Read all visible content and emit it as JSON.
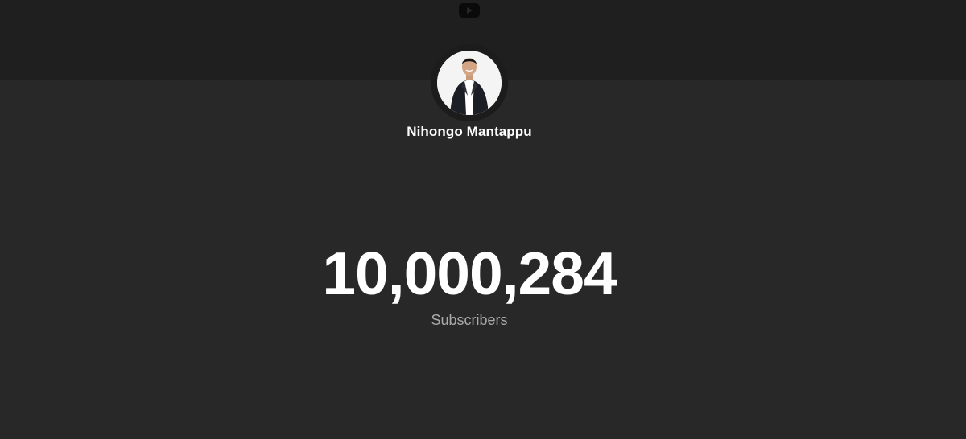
{
  "header": {
    "logo_icon": "youtube-icon",
    "background": "#1f1f1f"
  },
  "channel": {
    "name": "Nihongo Mantappu",
    "avatar_icon": "channel-avatar"
  },
  "stats": {
    "subscriber_count": "10,000,284",
    "subscriber_label": "Subscribers"
  },
  "colors": {
    "page_background": "#282828",
    "count_text": "#ffffff",
    "label_text": "#aaaaaa"
  }
}
